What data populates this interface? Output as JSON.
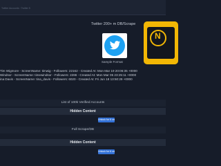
{
  "header": {
    "breadcrumb": "Twitter Accounts › Twitter 5"
  },
  "listing": {
    "title": "Twitter 200+ m DB/Scrape",
    "sample_caption": "Sample Format",
    "twitter_icon": "twitter-bird-icon",
    "brand_icon": "hexagon-logo-icon",
    "brand_color": "#f2b705",
    "twitter_color": "#1da1f2"
  },
  "records": [
    "Tim Wigmore - ScreenName: timwig - Followers: 22162 - Created At: Mon Mar 19 20:06:35 +0000",
    "Windsor - ScreenName: timewindsor - Followers: 2286 - Created At: Mon Mar 05 23:25:11 +0000",
    "ina Davis - ScreenName: tina_davis - Followers: 6020 - Created At: Fri Jun 18 13:50:29 +0000"
  ],
  "sections": [
    {
      "label": "List of 100k Verified Accounts",
      "hidden_label": "Hidden Content",
      "unlock_label": "Unlock for 6 credits"
    },
    {
      "label": "Full Scrape/DB",
      "hidden_label": "Hidden Content",
      "unlock_label": "Unlock for 6 credits"
    }
  ]
}
